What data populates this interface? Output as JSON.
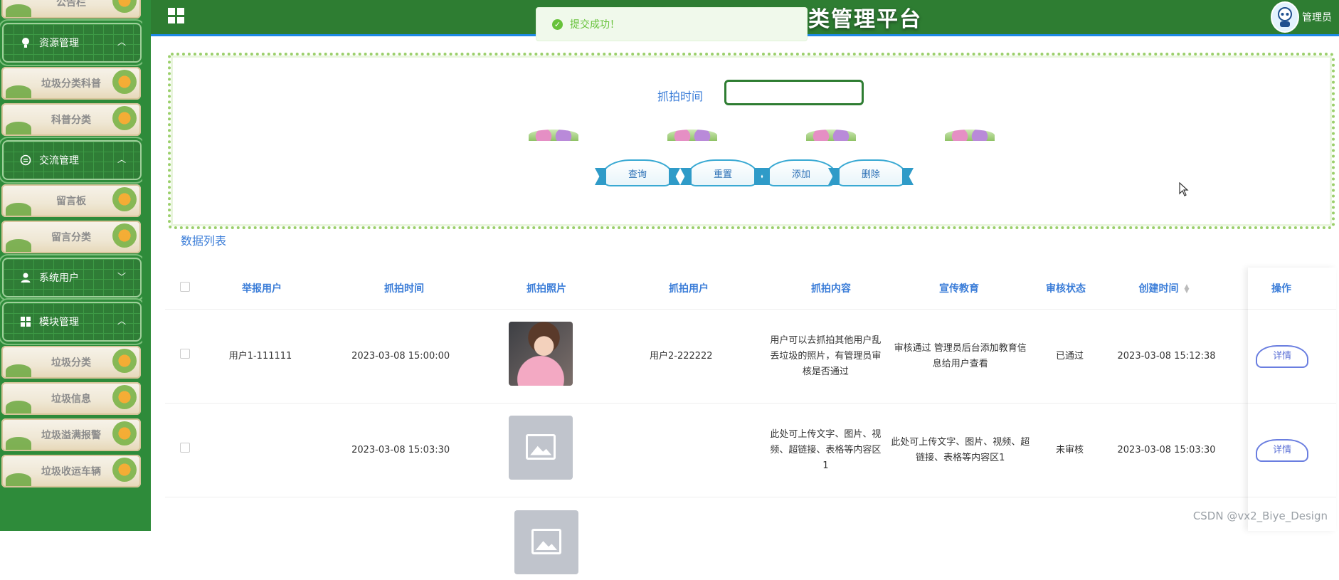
{
  "sidebar": {
    "items": [
      {
        "type": "sub",
        "label": "公告栏"
      },
      {
        "type": "group",
        "label": "资源管理",
        "icon": "bulb-icon"
      },
      {
        "type": "sub",
        "label": "垃圾分类科普"
      },
      {
        "type": "sub",
        "label": "科普分类"
      },
      {
        "type": "group",
        "label": "交流管理",
        "icon": "chat-icon"
      },
      {
        "type": "sub",
        "label": "留言板"
      },
      {
        "type": "sub",
        "label": "留言分类"
      },
      {
        "type": "group",
        "label": "系统用户",
        "icon": "user-icon"
      },
      {
        "type": "group",
        "label": "模块管理",
        "icon": "grid-icon"
      },
      {
        "type": "sub",
        "label": "垃圾分类"
      },
      {
        "type": "sub",
        "label": "垃圾信息"
      },
      {
        "type": "sub",
        "label": "垃圾溢满报警"
      },
      {
        "type": "sub",
        "label": "垃圾收运车辆"
      }
    ]
  },
  "header": {
    "title": "欢迎使用智能垃圾分类管理平台",
    "user": "管理员"
  },
  "toast": {
    "text": "提交成功！",
    "color": "#67c23a"
  },
  "search": {
    "label": "抓拍时间",
    "value": ""
  },
  "buttons": {
    "query": "查询",
    "reset": "重置",
    "add": "添加",
    "delete": "删除"
  },
  "list": {
    "title": "数据列表",
    "columns": [
      "举报用户",
      "抓拍时间",
      "抓拍照片",
      "抓拍用户",
      "抓拍内容",
      "宣传教育",
      "审核状态",
      "创建时间",
      "操作"
    ],
    "rows": [
      {
        "reporter": "用户1-111111",
        "time": "2023-03-08 15:00:00",
        "photo": "child-photo",
        "captured_user": "用户2-222222",
        "content": "用户可以去抓拍其他用户乱丢垃圾的照片，有管理员审核是否通过",
        "education": "审核通过 管理员后台添加教育信息给用户查看",
        "status": "已通过",
        "created": "2023-03-08 15:12:38",
        "action": "详情"
      },
      {
        "reporter": "",
        "time": "2023-03-08 15:03:30",
        "photo": "image-placeholder",
        "captured_user": "",
        "content": "此处可上传文字、图片、视频、超链接、表格等内容区1",
        "education": "此处可上传文字、图片、视频、超链接、表格等内容区1",
        "status": "未审核",
        "created": "2023-03-08 15:03:30",
        "action": "详情"
      },
      {
        "photo": "image-placeholder"
      }
    ]
  },
  "watermark": "CSDN @vx2_Biye_Design",
  "colors": {
    "primary": "#2e7d32",
    "accent": "#3b7dd8",
    "success": "#67c23a"
  }
}
